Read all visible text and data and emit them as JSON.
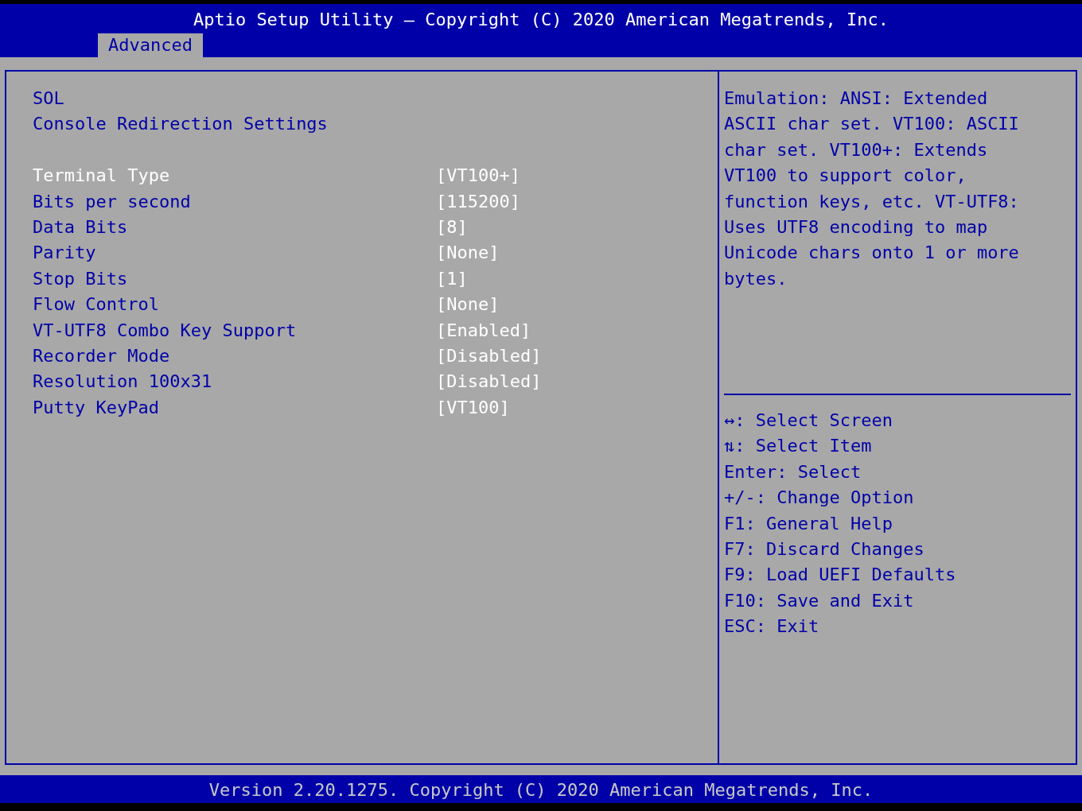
{
  "header": {
    "title": "Aptio Setup Utility – Copyright (C) 2020 American Megatrends, Inc.",
    "tabs": [
      {
        "label": "Advanced",
        "selected": true
      }
    ]
  },
  "main": {
    "headings": [
      "SOL",
      "Console Redirection Settings"
    ],
    "settings": [
      {
        "label": "Terminal Type",
        "value": "[VT100+]",
        "selected": true
      },
      {
        "label": "Bits per second",
        "value": "[115200]",
        "selected": false
      },
      {
        "label": "Data Bits",
        "value": "[8]",
        "selected": false
      },
      {
        "label": "Parity",
        "value": "[None]",
        "selected": false
      },
      {
        "label": "Stop Bits",
        "value": "[1]",
        "selected": false
      },
      {
        "label": "Flow Control",
        "value": "[None]",
        "selected": false
      },
      {
        "label": "VT-UTF8 Combo Key Support",
        "value": "[Enabled]",
        "selected": false
      },
      {
        "label": "Recorder Mode",
        "value": "[Disabled]",
        "selected": false
      },
      {
        "label": "Resolution 100x31",
        "value": "[Disabled]",
        "selected": false
      },
      {
        "label": "Putty KeyPad",
        "value": "[VT100]",
        "selected": false
      }
    ]
  },
  "help": {
    "description": "Emulation: ANSI: Extended ASCII char set. VT100: ASCII char set. VT100+: Extends VT100 to support color, function keys, etc. VT-UTF8: Uses UTF8 encoding to map Unicode chars onto 1 or more bytes.",
    "keys": [
      "↔: Select Screen",
      "⇅: Select Item",
      "Enter: Select",
      "+/-: Change Option",
      "F1: General Help",
      "F7: Discard Changes",
      "F9: Load UEFI Defaults",
      "F10: Save and Exit",
      "ESC: Exit"
    ]
  },
  "footer": {
    "text": "Version 2.20.1275. Copyright (C) 2020 American Megatrends, Inc."
  }
}
